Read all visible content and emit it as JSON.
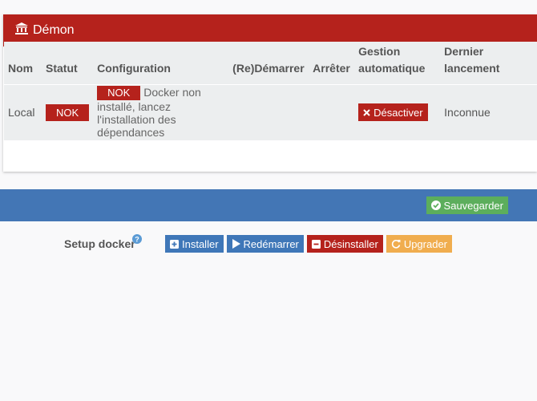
{
  "daemon": {
    "title": "Démon",
    "columns": [
      "Nom",
      "Statut",
      "Configuration",
      "(Re)Démarrer",
      "Arrêter",
      "Gestion automatique",
      "Dernier lancement"
    ],
    "row": {
      "name": "Local",
      "status": "NOK",
      "config_badge": "NOK",
      "config_text": "Docker non installé, lancez l'installation des dépendances",
      "auto_button": "Désactiver",
      "last_launch": "Inconnue"
    }
  },
  "toolbar": {
    "save_label": "Sauvegarder"
  },
  "setup": {
    "label": "Setup docker",
    "buttons": {
      "install": "Installer",
      "restart": "Redémarrer",
      "uninstall": "Désinstaller",
      "upgrade": "Upgrader"
    }
  },
  "colors": {
    "danger": "#b5221c",
    "primary": "#3f77b8",
    "success": "#5cae5c",
    "warning": "#f0ad4e"
  },
  "icons": [
    "bank-icon",
    "help-icon",
    "plus-square-icon",
    "play-icon",
    "minus-square-icon",
    "refresh-icon",
    "check-circle-icon",
    "times-icon"
  ]
}
